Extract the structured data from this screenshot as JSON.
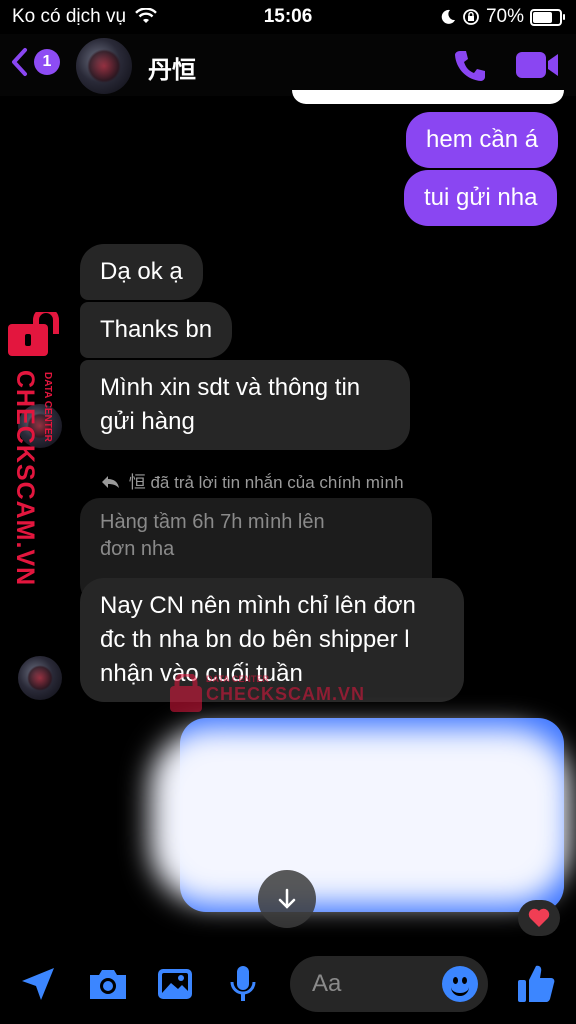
{
  "status": {
    "carrier": "Ko có dịch vụ",
    "time": "15:06",
    "battery": "70%"
  },
  "header": {
    "back_count": "1",
    "contact_name": "丹恒"
  },
  "messages": [
    {
      "side": "out",
      "text": "hem cần á"
    },
    {
      "side": "out",
      "text": "tui gửi nha"
    },
    {
      "side": "in",
      "text": "Dạ ok ạ"
    },
    {
      "side": "in",
      "text": "Thanks bn"
    },
    {
      "side": "in",
      "text": "Mình xin sdt và thông tin\ngửi hàng"
    },
    {
      "side": "in",
      "text": "Nay CN nên mình chỉ lên đơn\nđc th nha bn do bên shipper l\nnhận vào cuối tuần"
    }
  ],
  "reply": {
    "label": "恒 đã trả lời tin nhắn của chính mình",
    "quoted_text": "Hàng tầm 6h 7h mình lên\nđơn nha"
  },
  "watermark": {
    "brand": "CHECKSCAM.VN",
    "sub": "DATA CENTER"
  },
  "composer": {
    "placeholder": "Aa"
  },
  "colors": {
    "accent": "#8a46f2",
    "incoming": "#262626",
    "watermark": "#e3163e",
    "link_blue": "#3c86ff"
  },
  "icons": [
    "back-chevron-icon",
    "phone-icon",
    "video-camera-icon",
    "location-arrow-icon",
    "camera-icon",
    "image-icon",
    "microphone-icon",
    "emoji-icon",
    "thumbs-up-icon",
    "heart-icon",
    "arrow-down-icon",
    "reply-icon",
    "lock-icon"
  ]
}
